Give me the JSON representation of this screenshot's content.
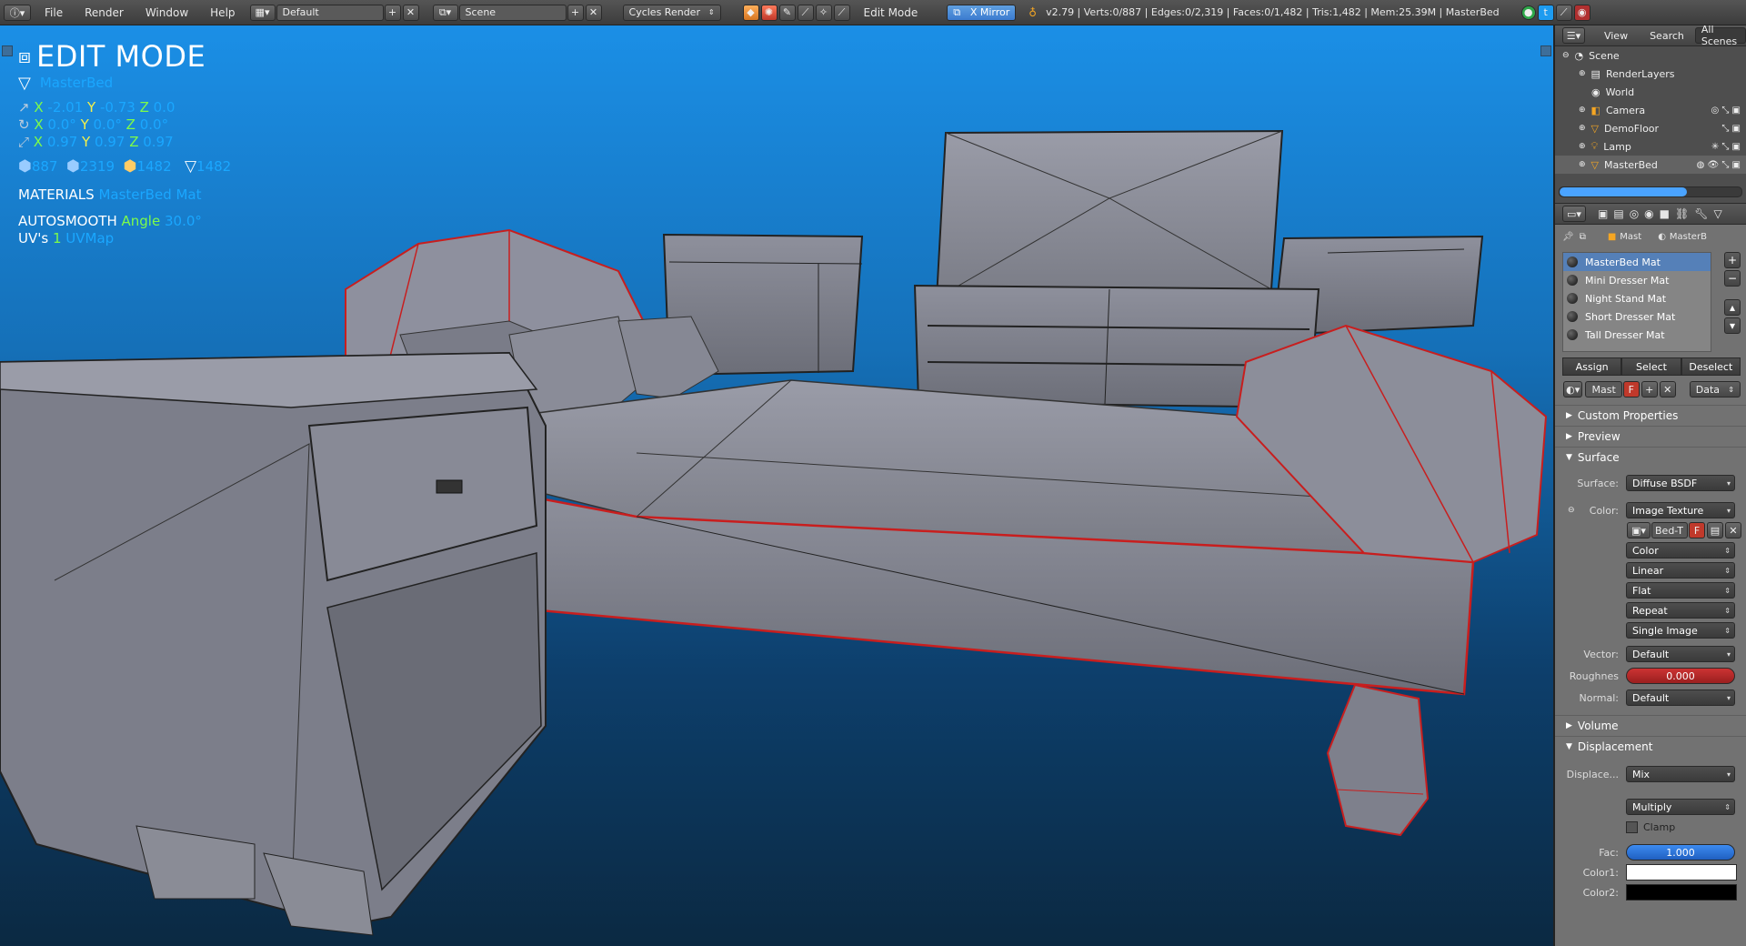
{
  "topbar": {
    "menus": [
      "File",
      "Render",
      "Window",
      "Help"
    ],
    "layout": "Default",
    "scene": "Scene",
    "engine": "Cycles Render",
    "mode": "Edit Mode",
    "mirror": "X Mirror",
    "stats": "v2.79 | Verts:0/887 | Edges:0/2,319 | Faces:0/1,482 | Tris:1,482 | Mem:25.39M | MasterBed"
  },
  "viewport": {
    "title": "EDIT MODE",
    "object_name": "MasterBed",
    "loc": {
      "x_label": "X",
      "x": "-2.01",
      "y_label": "Y",
      "y": "-0.73",
      "z_label": "Z",
      "z": "0.0"
    },
    "rot": {
      "x_label": "X",
      "x": "0.0°",
      "y_label": "Y",
      "y": "0.0°",
      "z_label": "Z",
      "z": "0.0°"
    },
    "scale": {
      "x_label": "X",
      "x": "0.97",
      "y_label": "Y",
      "y": "0.97",
      "z_label": "Z",
      "z": "0.97"
    },
    "counts": {
      "verts": "887",
      "edges": "2319",
      "faces": "1482",
      "tris": "1482"
    },
    "materials_label": "MATERIALS",
    "materials_value": "MasterBed Mat",
    "autosmooth_label": "AUTOSMOOTH",
    "angle_label": "Angle",
    "angle_value": "30.0°",
    "uvs_label": "UV's",
    "uvs_count": "1",
    "uvs_name": "UVMap"
  },
  "outliner": {
    "header": {
      "view": "View",
      "search": "Search",
      "scenes": "All Scenes"
    },
    "items": [
      {
        "label": "Scene"
      },
      {
        "label": "RenderLayers"
      },
      {
        "label": "World"
      },
      {
        "label": "Camera"
      },
      {
        "label": "DemoFloor"
      },
      {
        "label": "Lamp"
      },
      {
        "label": "MasterBed"
      }
    ]
  },
  "properties": {
    "context": {
      "mat": "Mast",
      "obj": "MasterB"
    },
    "materials": [
      "MasterBed Mat",
      "Mini Dresser Mat",
      "Night Stand Mat",
      "Short Dresser Mat",
      "Tall Dresser Mat"
    ],
    "assign": "Assign",
    "select": "Select",
    "deselect": "Deselect",
    "mat_field": "Mast",
    "mat_f": "F",
    "data_dd": "Data",
    "sections": {
      "custom": "Custom Properties",
      "preview": "Preview",
      "surface": "Surface",
      "volume": "Volume",
      "displacement": "Displacement"
    },
    "surface": {
      "surface_label": "Surface:",
      "surface_value": "Diffuse BSDF",
      "color_label": "Color:",
      "color_value": "Image Texture",
      "image_name": "Bed-T",
      "image_f": "F",
      "color_space": "Color",
      "interpolation": "Linear",
      "projection": "Flat",
      "extension": "Repeat",
      "source": "Single Image",
      "vector_label": "Vector:",
      "vector_value": "Default",
      "roughness_label": "Roughnes",
      "roughness_value": "0.000",
      "normal_label": "Normal:",
      "normal_value": "Default"
    },
    "displacement": {
      "label": "Displace...",
      "value": "Mix",
      "blend": "Multiply",
      "clamp": "Clamp",
      "fac_label": "Fac:",
      "fac_value": "1.000",
      "color1_label": "Color1:",
      "color2_label": "Color2:"
    }
  },
  "colors": {
    "accent": "#1aa7ff",
    "selected_edge": "#c81e1e",
    "mesh_face": "#8a8c98"
  }
}
